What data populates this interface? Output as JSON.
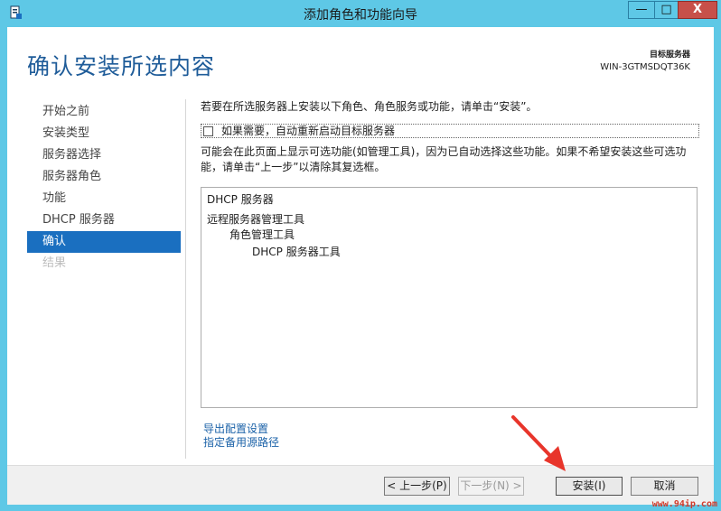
{
  "window": {
    "title": "添加角色和功能向导",
    "minimize_symbol": "—",
    "maximize_symbol": "□",
    "close_symbol": "X"
  },
  "header": {
    "page_title": "确认安装所选内容",
    "target_label": "目标服务器",
    "target_server": "WIN-3GTMSDQT36K"
  },
  "nav": {
    "items": [
      {
        "label": "开始之前",
        "state": "normal"
      },
      {
        "label": "安装类型",
        "state": "normal"
      },
      {
        "label": "服务器选择",
        "state": "normal"
      },
      {
        "label": "服务器角色",
        "state": "normal"
      },
      {
        "label": "功能",
        "state": "normal"
      },
      {
        "label": "DHCP 服务器",
        "state": "normal"
      },
      {
        "label": "确认",
        "state": "active"
      },
      {
        "label": "结果",
        "state": "disabled"
      }
    ]
  },
  "main": {
    "intro": "若要在所选服务器上安装以下角色、角色服务或功能，请单击“安装”。",
    "restart_checkbox": {
      "label": "如果需要，自动重新启动目标服务器",
      "checked": false
    },
    "note_line1": "可能会在此页面上显示可选功能(如管理工具)，因为已自动选择这些功能。如果不希望安装这些可选功",
    "note_line2": "能，请单击“上一步”以清除其复选框。",
    "selections": [
      {
        "label": "DHCP 服务器",
        "level": 0
      },
      {
        "label": "远程服务器管理工具",
        "level": 0
      },
      {
        "label": "角色管理工具",
        "level": 1
      },
      {
        "label": "DHCP 服务器工具",
        "level": 2
      }
    ],
    "links": {
      "export": "导出配置设置",
      "alt_source": "指定备用源路径"
    }
  },
  "footer": {
    "prev": "< 上一步(P)",
    "next": "下一步(N) >",
    "install": "安装(I)",
    "cancel": "取消"
  },
  "watermark": "www.94ip.com",
  "colors": {
    "chrome": "#5ec8e6",
    "title_text": "#1f5c99",
    "nav_active": "#1a6fc0",
    "link": "#1b62a8",
    "close_button": "#c7504a",
    "annotation_arrow": "#e8352b"
  }
}
